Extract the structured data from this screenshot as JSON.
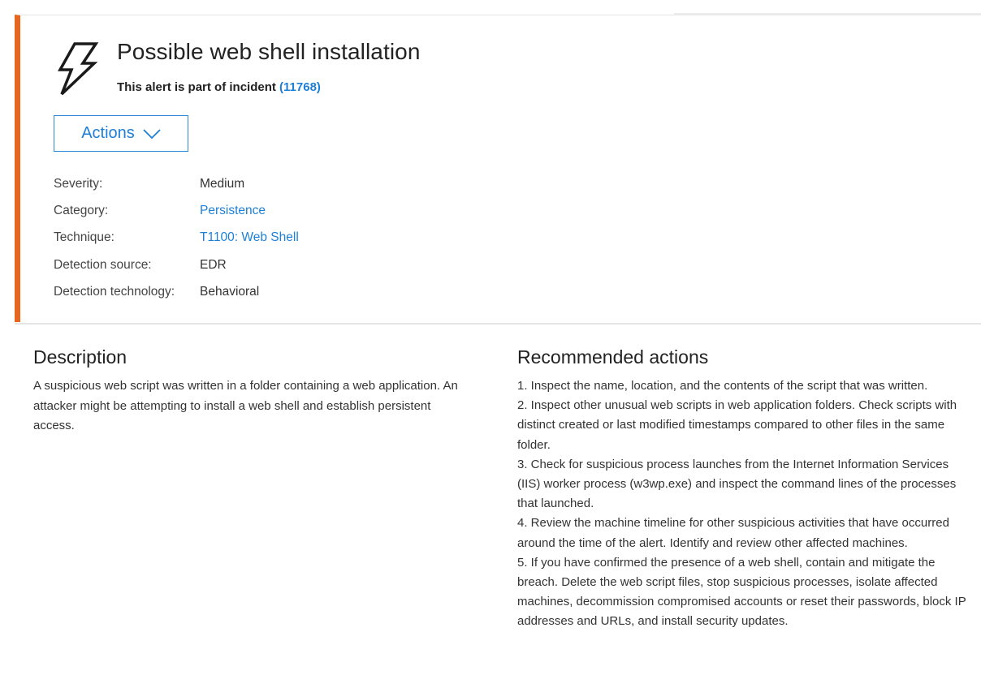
{
  "alert": {
    "title": "Possible web shell installation",
    "subtitle_prefix": "This alert is part of incident ",
    "incident_link": "(11768)",
    "icon": "lightning-bolt-icon",
    "accent_color": "#e8651f"
  },
  "actions_button": {
    "label": "Actions",
    "icon": "chevron-down-icon"
  },
  "properties": [
    {
      "key": "Severity:",
      "value": "Medium"
    },
    {
      "key": "Category:",
      "value": "Persistence"
    },
    {
      "key": "Technique:",
      "value": "T1100: Web Shell"
    },
    {
      "key": "Detection source:",
      "value": "EDR"
    },
    {
      "key": "Detection technology:",
      "value": "Behavioral"
    }
  ],
  "description": {
    "title": "Description",
    "text": "A suspicious web script was written in a folder containing a web application. An attacker might be attempting to install a web shell and establish persistent access."
  },
  "recommended": {
    "title": "Recommended actions",
    "items": [
      "1. Inspect the name, location, and the contents of the script that was written.",
      "2. Inspect other unusual web scripts in web application folders. Check scripts with distinct created or last modified timestamps compared to other files in the same folder.",
      "3. Check for suspicious process launches from the Internet Information Services (IIS) worker process (w3wp.exe) and inspect the command lines of the processes that launched.",
      "4. Review the machine timeline for other suspicious activities that have occurred around the time of the alert. Identify and review other affected machines.",
      "5. If you have confirmed the presence of a web shell, contain and mitigate the breach. Delete the web script files, stop suspicious processes, isolate affected machines, decommission compromised accounts or reset their passwords, block IP addresses and URLs, and install security updates."
    ]
  }
}
